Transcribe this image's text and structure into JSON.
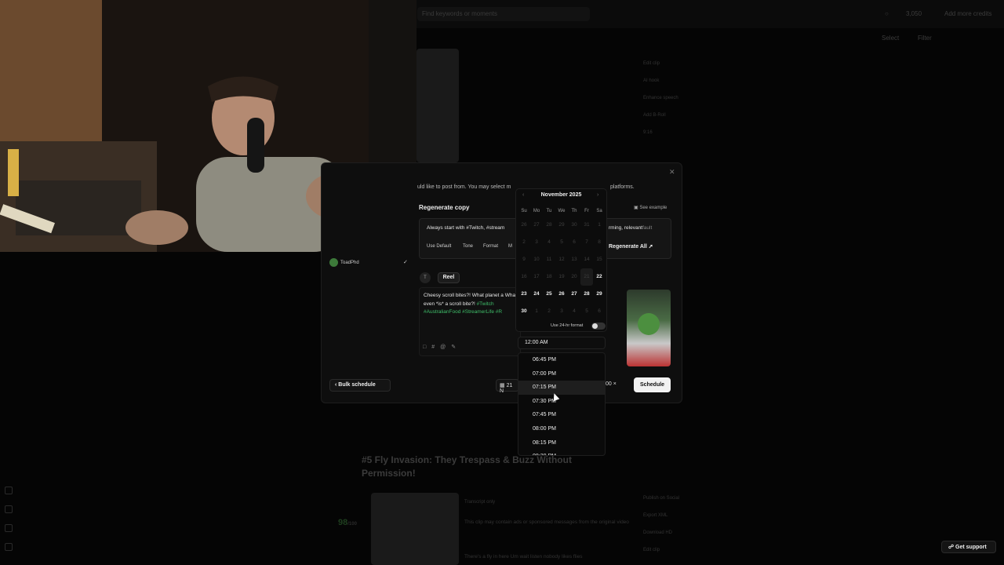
{
  "background": {
    "search_placeholder": "Find keywords or moments",
    "credits": "3,050",
    "add_credits": "Add more credits",
    "toolbar": [
      "Select",
      "Filter"
    ],
    "side_actions_top": [
      "Edit clip",
      "AI hook",
      "Enhance speech",
      "Add B-Roll",
      "9:16"
    ],
    "clip_title": "#5 Fly Invasion: They Trespass & Buzz Without Permission!",
    "clip_score": "98",
    "clip_score_suffix": "/100",
    "transcript_label": "Transcript only",
    "notice": "This clip may contain ads or sponsored messages from the original video",
    "transcript_line": "There's a fly in here Um wait listen nobody likes flies",
    "side_actions_bottom": [
      "Publish on Social",
      "Export XML",
      "Download HD",
      "Edit clip"
    ]
  },
  "modal": {
    "hint": "uld like to post from. You may select m",
    "hint_end": "platforms.",
    "regen_title": "Regenerate copy",
    "see_example": "See example",
    "prompt_start": "Always start with #Twitch, #stream",
    "prompt_end": "rming, relevant",
    "prompt_suffix": "fault",
    "chips": [
      "Use Default",
      "Tone",
      "Format",
      "M"
    ],
    "regenerate_all": "Regenerate All",
    "account_name": "ToadPhd",
    "avatar_letter": "T",
    "post_type": "Reel",
    "caption_text": "Cheesy scroll bites?! What planet a What even *is* a scroll bite?! ",
    "caption_tag1": "#Twitch",
    "caption_tags": "#AustralianFood #StreamerLife #R",
    "bulk_schedule": "Bulk schedule",
    "date_short": "21 N",
    "time_short": ":00",
    "schedule": "Schedule"
  },
  "calendar": {
    "month": "November 2025",
    "weekdays": [
      "Su",
      "Mo",
      "Tu",
      "We",
      "Th",
      "Fr",
      "Sa"
    ],
    "format_label": "Use 24-hr format",
    "selected_time": "12:00 AM",
    "time_options": [
      "06:45 PM",
      "07:00 PM",
      "07:15 PM",
      "07:30 PM",
      "07:45 PM",
      "08:00 PM",
      "08:15 PM",
      "08:30 PM"
    ],
    "hovered_index": 2
  },
  "support": "Get support"
}
